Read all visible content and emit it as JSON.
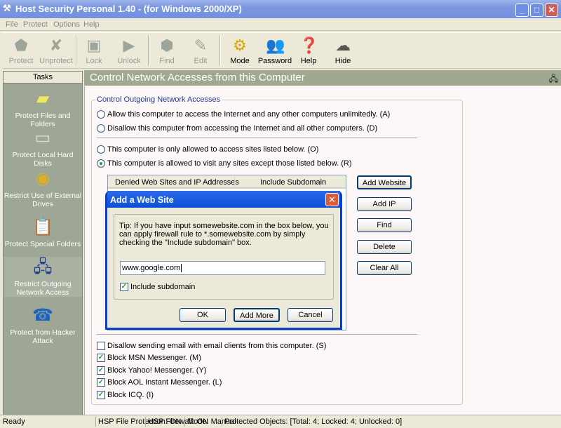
{
  "window": {
    "title": "Host Security Personal 1.40 - (for Windows 2000/XP)",
    "minimize": "_",
    "maximize": "□",
    "close": "✕"
  },
  "menu": [
    "File",
    "Protect",
    "Options",
    "Help"
  ],
  "toolbar": [
    {
      "label": "Protect",
      "icon": "protect-icon",
      "enabled": false
    },
    {
      "label": "Unprotect",
      "icon": "unprotect-icon",
      "enabled": false
    },
    {
      "label": "Lock",
      "icon": "lock-icon",
      "enabled": false
    },
    {
      "label": "Unlock",
      "icon": "unlock-icon",
      "enabled": false
    },
    {
      "label": "Find",
      "icon": "find-icon",
      "enabled": false
    },
    {
      "label": "Edit",
      "icon": "edit-icon",
      "enabled": false
    },
    {
      "label": "Mode",
      "icon": "mode-icon",
      "enabled": true
    },
    {
      "label": "Password",
      "icon": "password-icon",
      "enabled": true
    },
    {
      "label": "Help",
      "icon": "help-book-icon",
      "enabled": true
    },
    {
      "label": "Hide",
      "icon": "cloud-icon",
      "enabled": true
    }
  ],
  "sidebar": {
    "header": "Tasks",
    "items": [
      {
        "label": "Protect Files and Folders",
        "icon": "folder-icon"
      },
      {
        "label": "Protect Local Hard Disks",
        "icon": "hard-disk-icon"
      },
      {
        "label": "Restrict Use of External Drives",
        "icon": "cd-icon"
      },
      {
        "label": "Protect Special Folders",
        "icon": "clipboard-icon"
      },
      {
        "label": "Restrict Outgoing Network Access",
        "icon": "network-icon"
      },
      {
        "label": "Protect from Hacker Attack",
        "icon": "globe-phone-icon"
      }
    ]
  },
  "main": {
    "title": "Control Network Accesses from this Computer",
    "group_label": "Control Outgoing Network Accesses",
    "radios": [
      {
        "label": "Allow this computer to access the Internet and any other computers unlimitedly. (A)",
        "checked": false
      },
      {
        "label": "Disallow this computer from accessing the Internet and all other computers. (D)",
        "checked": false
      },
      {
        "label": "This computer is only allowed to access sites listed below. (O)",
        "checked": false
      },
      {
        "label": "This computer is allowed to visit any sites except those listed below. (R)",
        "checked": true
      }
    ],
    "list_columns": [
      "Denied Web Sites and IP Addresses",
      "Include Subdomain"
    ],
    "buttons": [
      "Add Website",
      "Add IP",
      "Find",
      "Delete",
      "Clear All"
    ],
    "checkboxes": [
      {
        "label": "Disallow sending email with email clients from this computer. (S)",
        "checked": false
      },
      {
        "label": "Block MSN Messenger. (M)",
        "checked": true
      },
      {
        "label": "Block Yahoo! Messenger. (Y)",
        "checked": true
      },
      {
        "label": "Block AOL Instant Messenger. (L)",
        "checked": true
      },
      {
        "label": "Block ICQ. (I)",
        "checked": true
      }
    ]
  },
  "dialog": {
    "title": "Add a Web Site",
    "tip": "Tip: If you have input somewebsite.com in the box below, you can apply firewall rule to *.somewebsite.com by simply checking the \"Include subdomain\" box.",
    "input_value": "www.google.com",
    "include_subdomain_label": "Include subdomain",
    "include_subdomain": true,
    "ok": "OK",
    "add_more": "Add More",
    "cancel": "Cancel"
  },
  "status": [
    "Ready",
    "HSP File Protection: ON",
    "HSP Firewall: ON",
    "Mode: Manual",
    "Protected Objects: [Total: 4; Locked: 4; Unlocked: 0]"
  ]
}
